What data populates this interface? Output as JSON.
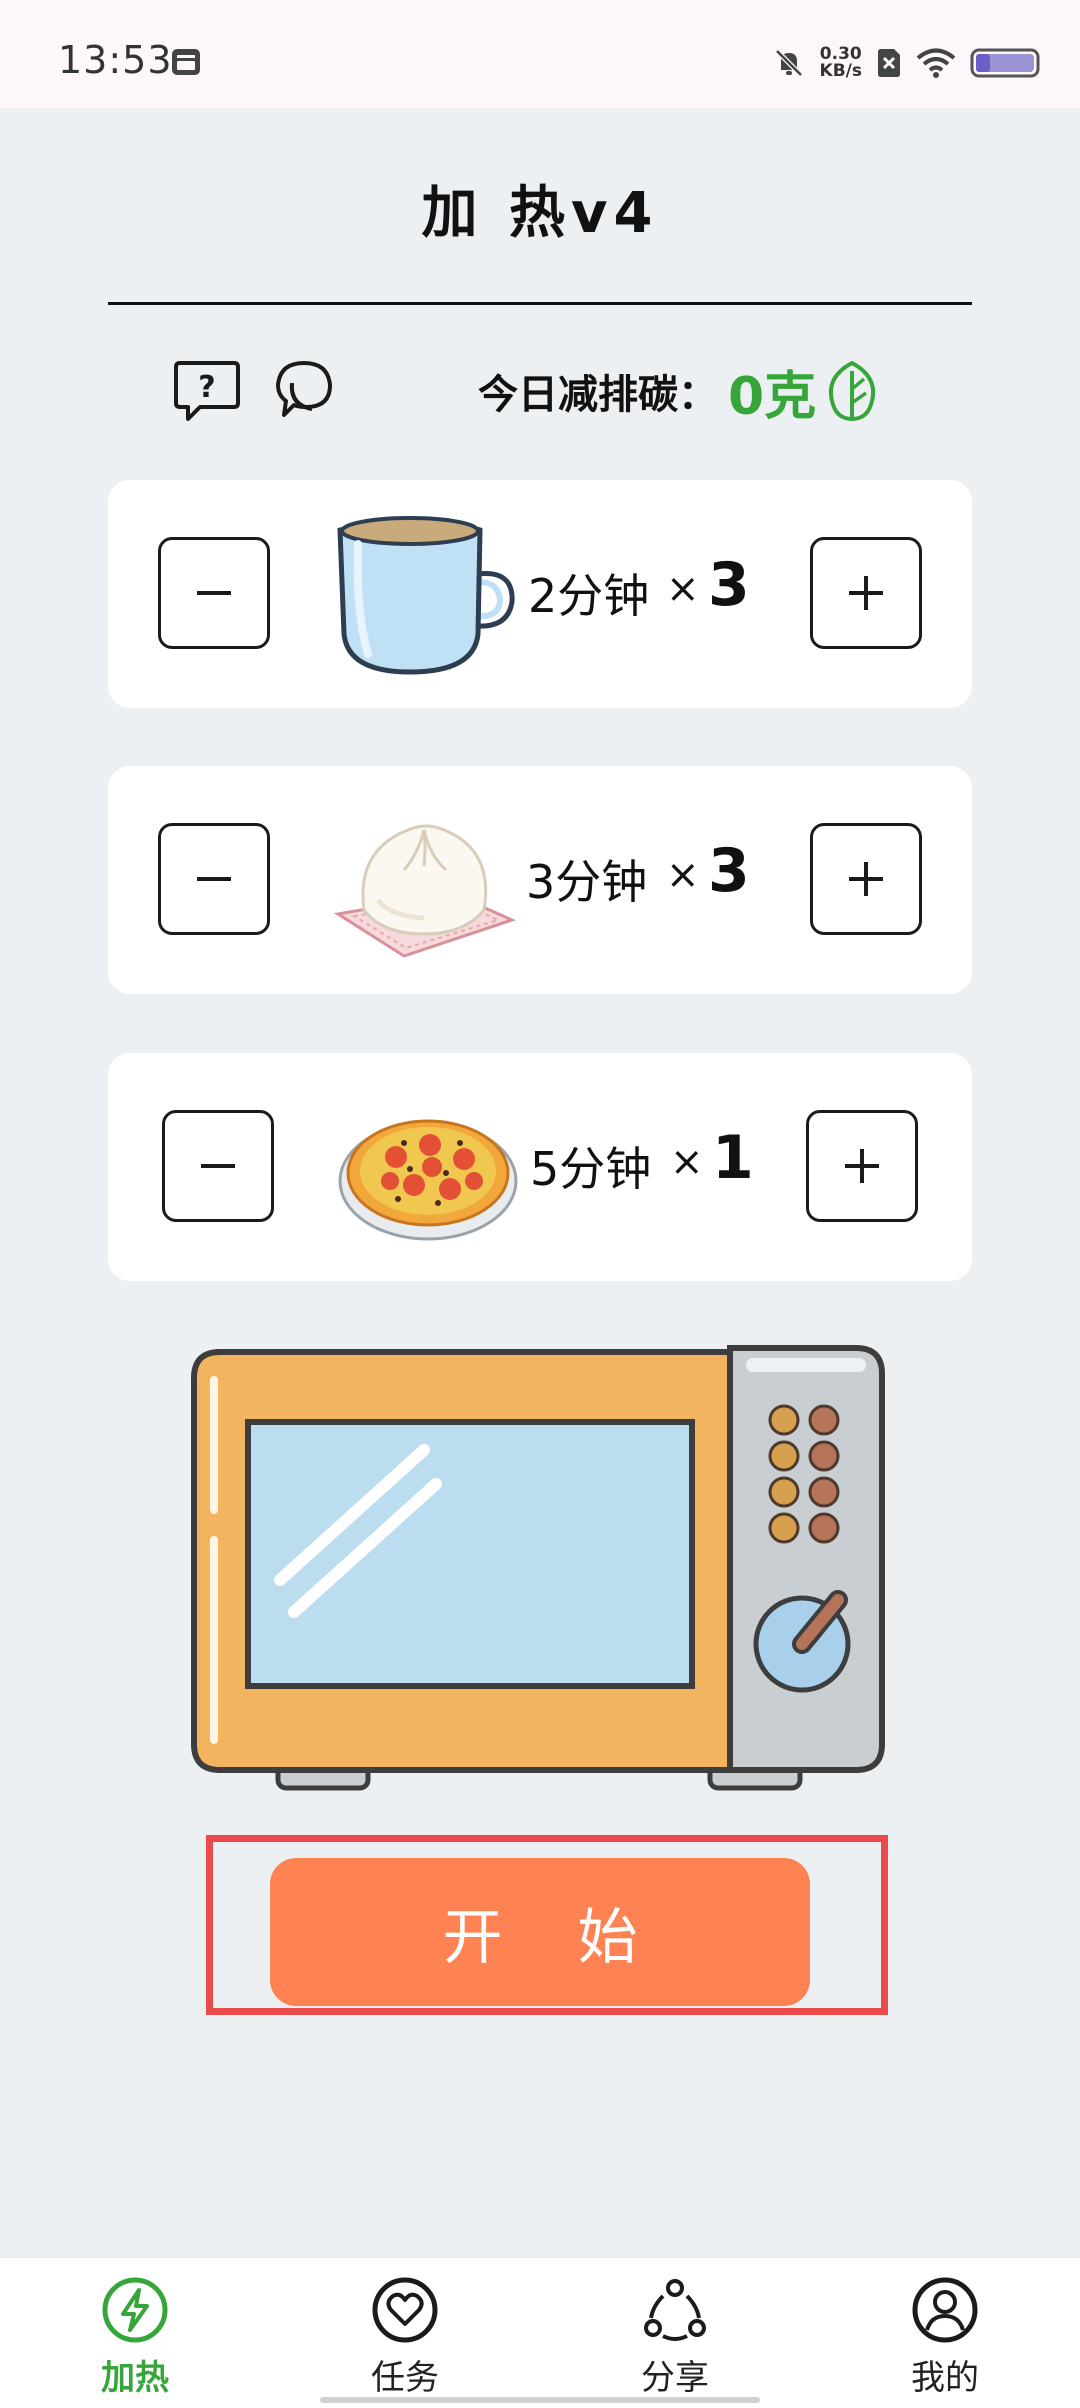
{
  "status_bar": {
    "time": "13:53",
    "net_speed_value": "0.30",
    "net_speed_unit": "KB/s",
    "icons": [
      "calendar-icon",
      "mute-bell-icon",
      "sim-off-icon",
      "wifi-icon",
      "battery-icon"
    ]
  },
  "header": {
    "title": "加 热v4"
  },
  "carbon": {
    "label": "今日减排碳：",
    "value": "0克"
  },
  "foods": [
    {
      "name_icon": "mug-icon",
      "time": "2分钟",
      "times_sign": "×",
      "count": "3"
    },
    {
      "name_icon": "steamed-bun-icon",
      "time": "3分钟",
      "times_sign": "×",
      "count": "3"
    },
    {
      "name_icon": "pizza-icon",
      "time": "5分钟",
      "times_sign": "×",
      "count": "1"
    }
  ],
  "start_button": {
    "label": "开 始"
  },
  "nav": {
    "items": [
      {
        "label": "加热",
        "icon": "lightning-circle-icon",
        "active": true
      },
      {
        "label": "任务",
        "icon": "heart-circle-icon",
        "active": false
      },
      {
        "label": "分享",
        "icon": "share-icon",
        "active": false
      },
      {
        "label": "我的",
        "icon": "profile-icon",
        "active": false
      }
    ]
  },
  "colors": {
    "accent_green": "#37a63a",
    "start_orange": "#ff8352",
    "highlight_red": "#ea4a4a",
    "background": "#edf0f3"
  }
}
